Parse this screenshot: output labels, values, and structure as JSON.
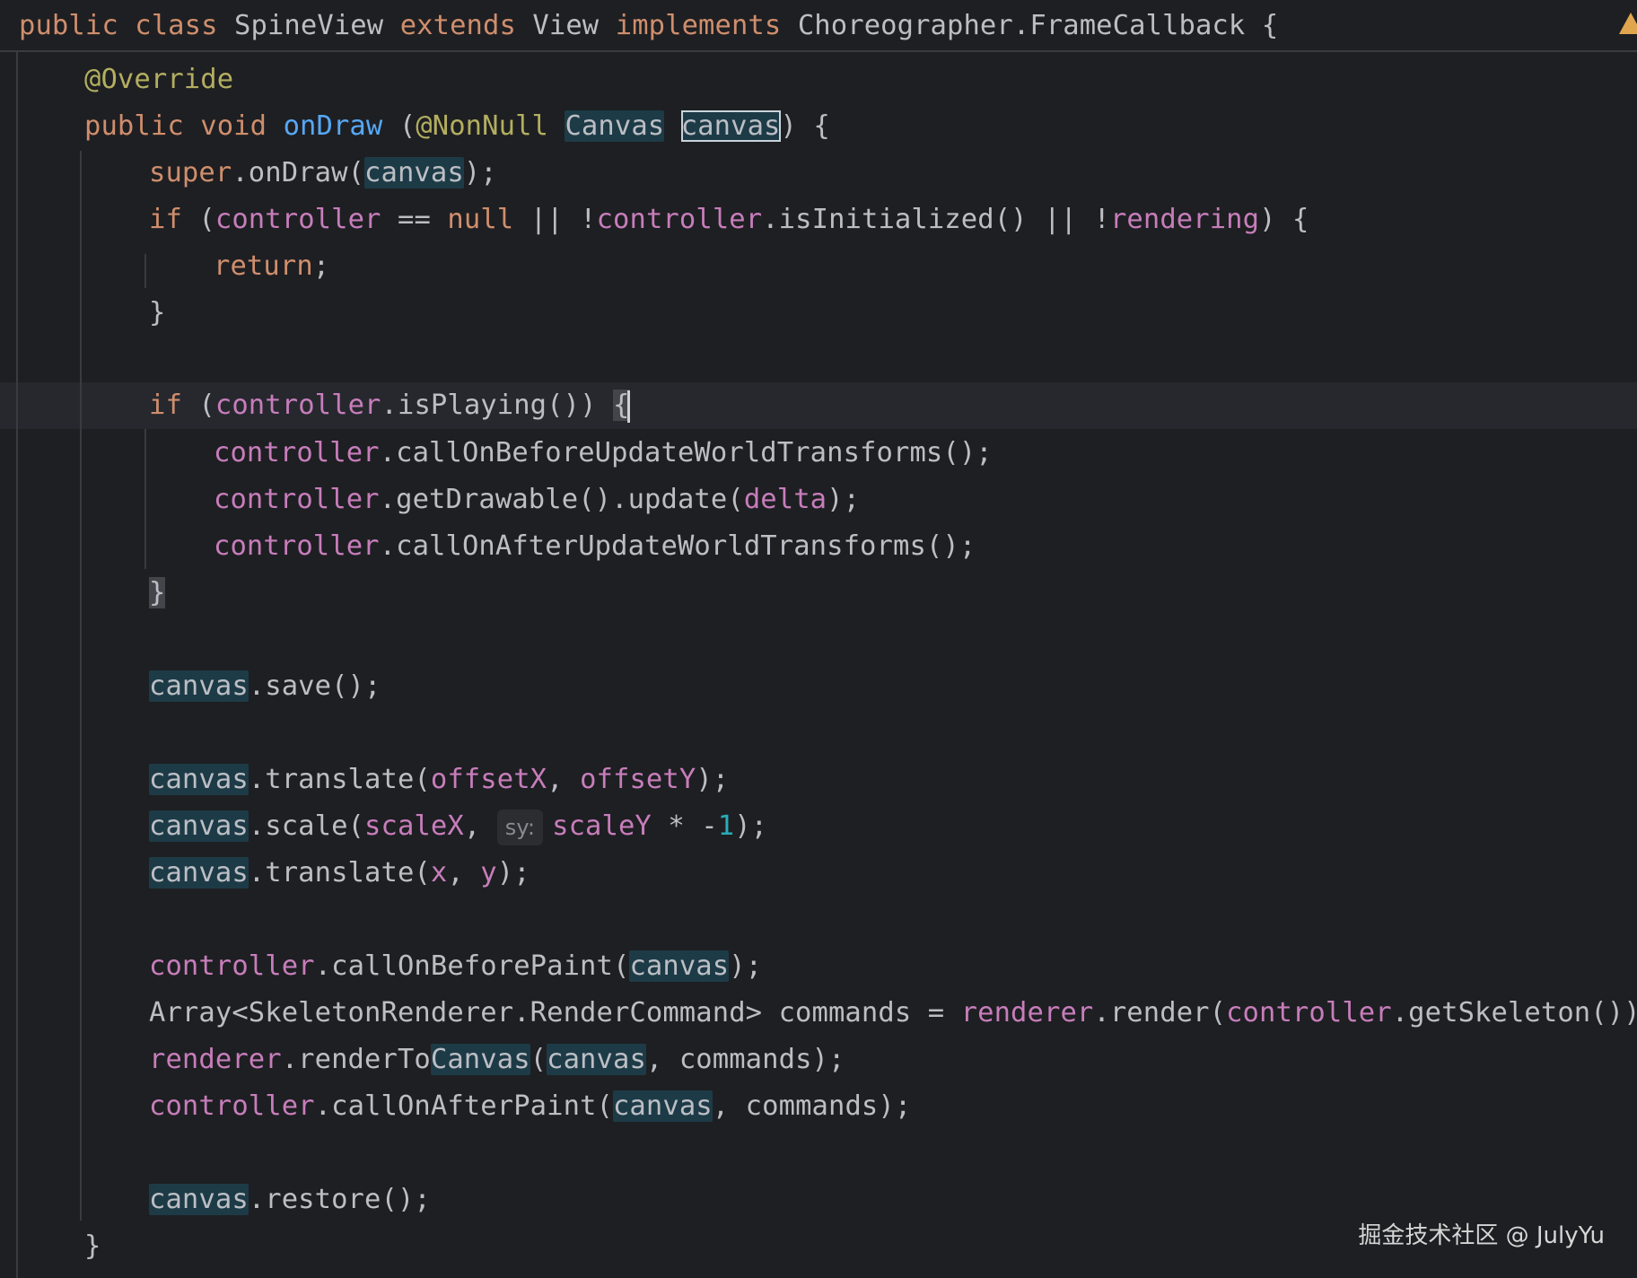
{
  "code": {
    "class_decl": {
      "public": "public",
      "class": "class",
      "name": "SpineView",
      "extends": "extends",
      "parent": "View",
      "implements": "implements",
      "iface": "Choreographer.FrameCallback",
      "brace": "{"
    },
    "annotation": "@Override",
    "method_sig": {
      "public": "public",
      "void": "void",
      "name": "onDraw",
      "open": "(",
      "nonnull": "@NonNull",
      "type": "Canvas",
      "param": "canvas",
      "close": ") {"
    },
    "super_call": {
      "super": "super",
      "call": ".onDraw(",
      "arg": "canvas",
      "end": ");"
    },
    "if_check": {
      "if": "if",
      "open": "(",
      "controller": "controller",
      "eq": "==",
      "null": "null",
      "or1": "|| !",
      "controller2": "controller",
      "call": ".isInitialized() || !",
      "rendering": "rendering",
      "close": ") {"
    },
    "return_kw": "return",
    "return_end": ";",
    "close_brace": "}",
    "if_playing": {
      "if": "if",
      "open": "(",
      "controller": "controller",
      "call": ".isPlaying())",
      "brace": "{"
    },
    "before_update": {
      "obj": "controller",
      "call": ".callOnBeforeUpdateWorldTransforms();"
    },
    "update": {
      "obj": "controller",
      "call": ".getDrawable().update(",
      "arg": "delta",
      "end": ");"
    },
    "after_update": {
      "obj": "controller",
      "call": ".callOnAfterUpdateWorldTransforms();"
    },
    "save": {
      "obj": "canvas",
      "call": ".save();"
    },
    "translate1": {
      "obj": "canvas",
      "call": ".translate(",
      "a": "offsetX",
      "sep": ",",
      "b": "offsetY",
      "end": ");"
    },
    "scale": {
      "obj": "canvas",
      "call": ".scale(",
      "a": "scaleX",
      "sep": ",",
      "hint": "sy:",
      "b": "scaleY",
      "mul": "* -",
      "num": "1",
      "end": ");"
    },
    "translate2": {
      "obj": "canvas",
      "call": ".translate(",
      "a": "x",
      "sep": ",",
      "b": "y",
      "end": ");"
    },
    "before_paint": {
      "obj": "controller",
      "call": ".callOnBeforePaint(",
      "arg": "canvas",
      "end": ");"
    },
    "commands_decl": {
      "type": "Array<SkeletonRenderer.RenderCommand> commands = ",
      "renderer": "renderer",
      "call": ".render(",
      "controller": "controller",
      "end": ".getSkeleton());"
    },
    "render_to_canvas": {
      "renderer": "renderer",
      "call_pre": ".renderTo",
      "call_hl": "Canvas",
      "open": "(",
      "arg": "canvas",
      "end": ", commands);"
    },
    "after_paint": {
      "obj": "controller",
      "call": ".callOnAfterPaint(",
      "arg": "canvas",
      "end": ", commands);"
    },
    "restore": {
      "obj": "canvas",
      "call": ".restore();"
    },
    "method_close": "}"
  },
  "watermark": "掘金技术社区 @ JulyYu",
  "warning_icon": "warning-icon",
  "colors": {
    "background": "#1e1f22",
    "keyword": "#cf8e6d",
    "annotation": "#b3ae60",
    "method_decl": "#56a8f5",
    "field": "#c77dbb",
    "number": "#2aacb8",
    "text": "#bcbec4",
    "highlight": "#1d3b47"
  }
}
